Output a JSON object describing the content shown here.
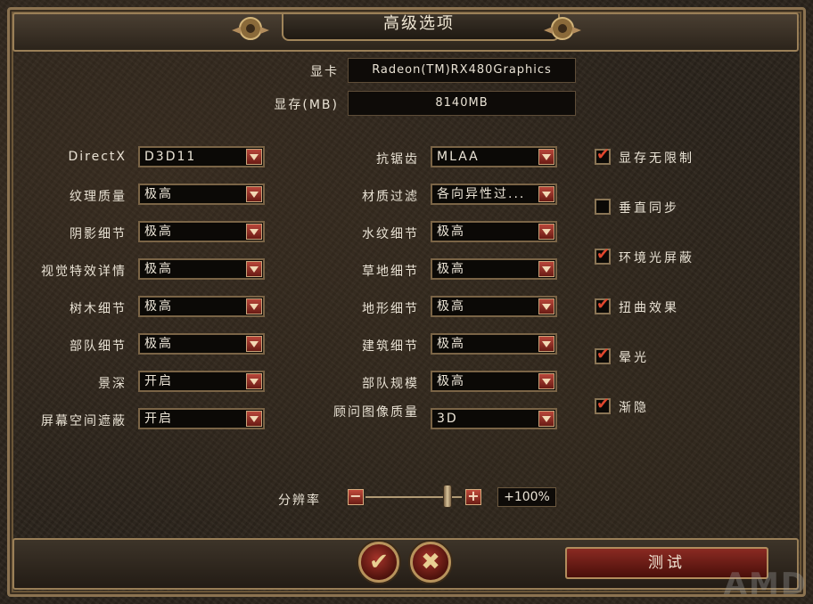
{
  "window": {
    "title": "高级选项"
  },
  "info": {
    "gpu_label": "显卡",
    "gpu_value": "Radeon(TM)RX480Graphics",
    "vram_label": "显存(MB)",
    "vram_value": "8140MB"
  },
  "left_settings": [
    {
      "label": "DirectX",
      "value": "D3D11"
    },
    {
      "label": "纹理质量",
      "value": "极高"
    },
    {
      "label": "阴影细节",
      "value": "极高"
    },
    {
      "label": "视觉特效详情",
      "value": "极高"
    },
    {
      "label": "树木细节",
      "value": "极高"
    },
    {
      "label": "部队细节",
      "value": "极高"
    },
    {
      "label": "景深",
      "value": "开启"
    },
    {
      "label": "屏幕空间遮蔽",
      "value": "开启"
    }
  ],
  "mid_settings": [
    {
      "label": "抗锯齿",
      "value": "MLAA"
    },
    {
      "label": "材质过滤",
      "value": "各向异性过..."
    },
    {
      "label": "水纹细节",
      "value": "极高"
    },
    {
      "label": "草地细节",
      "value": "极高"
    },
    {
      "label": "地形细节",
      "value": "极高"
    },
    {
      "label": "建筑细节",
      "value": "极高"
    },
    {
      "label": "部队规模",
      "value": "极高"
    },
    {
      "label": "顾问图像质量",
      "value": "3D"
    }
  ],
  "checkboxes": [
    {
      "label": "显存无限制",
      "checked": true
    },
    {
      "label": "垂直同步",
      "checked": false
    },
    {
      "label": "环境光屏蔽",
      "checked": true
    },
    {
      "label": "扭曲效果",
      "checked": true
    },
    {
      "label": "晕光",
      "checked": true
    },
    {
      "label": "渐隐",
      "checked": true
    }
  ],
  "resolution": {
    "label": "分辨率",
    "value": "+100%",
    "minus": "−",
    "plus": "+",
    "level": 0.85
  },
  "footer": {
    "confirm_glyph": "✔",
    "cancel_glyph": "✖",
    "test_label": "测试"
  },
  "watermark": "AMD",
  "colors": {
    "accent": "#c9442f",
    "frame": "#9a7f57",
    "text": "#e9e2d4"
  }
}
